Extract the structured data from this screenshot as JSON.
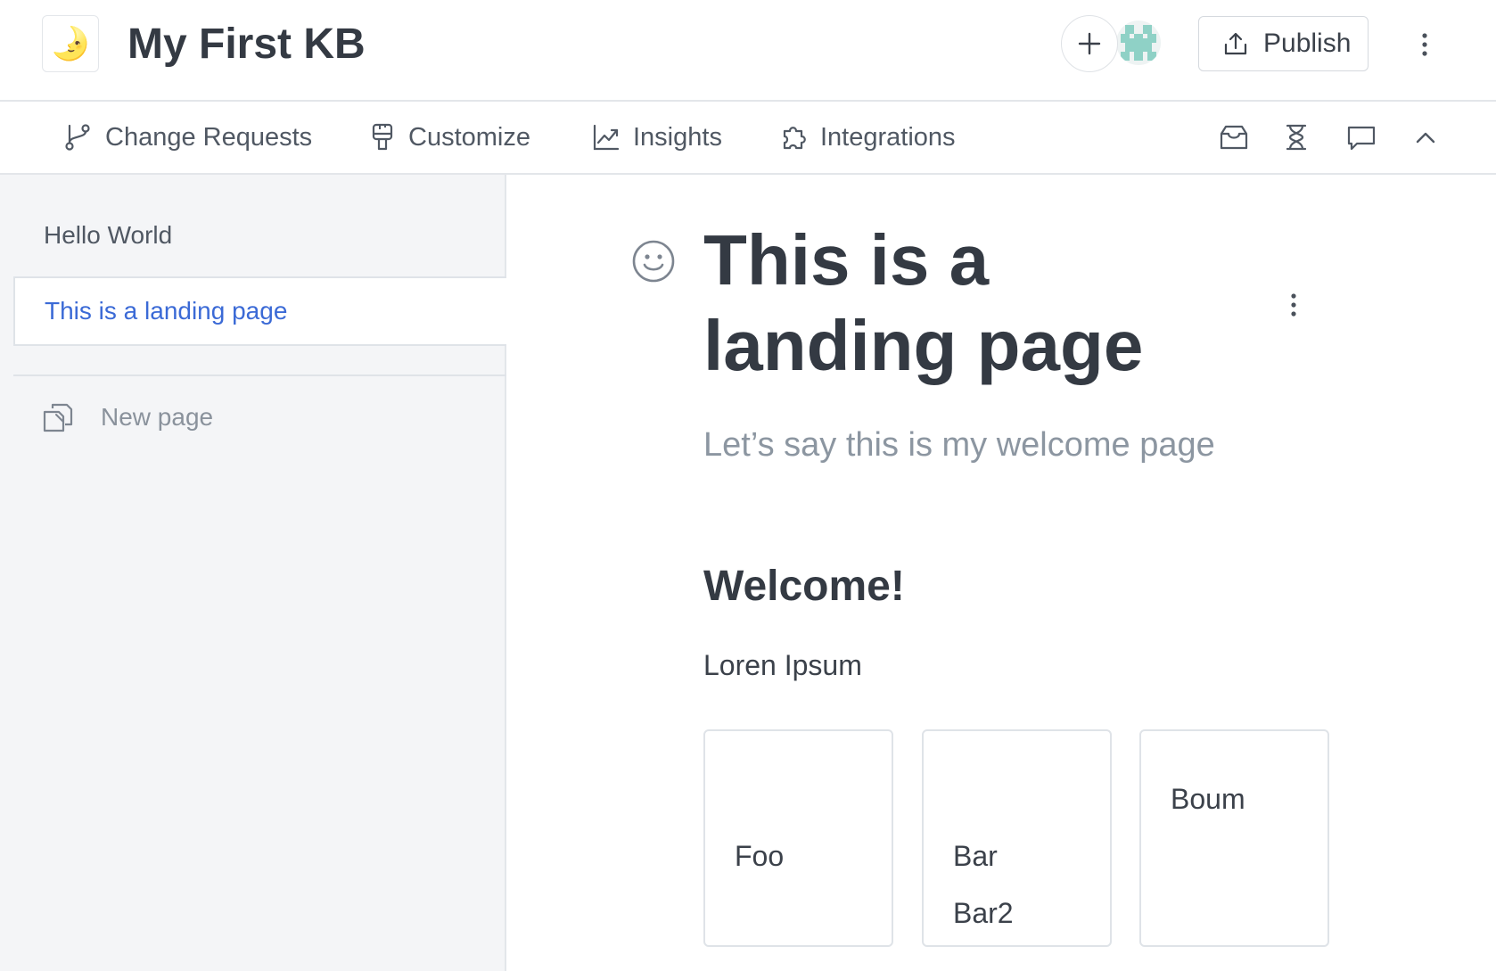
{
  "header": {
    "logo_glyph": "🌛",
    "title": "My First KB",
    "add_icon": "plus-icon",
    "publish_label": "Publish"
  },
  "toolbar": {
    "items": [
      {
        "label": "Change Requests",
        "icon": "branch-icon"
      },
      {
        "label": "Customize",
        "icon": "paintbrush-icon"
      },
      {
        "label": "Insights",
        "icon": "chart-icon"
      },
      {
        "label": "Integrations",
        "icon": "puzzle-icon"
      }
    ],
    "right_icons": [
      "inbox-icon",
      "hourglass-icon",
      "comment-icon",
      "chevron-up-icon"
    ]
  },
  "sidebar": {
    "items": [
      {
        "label": "Hello World",
        "active": false
      },
      {
        "label": "This is a landing page",
        "active": true
      }
    ],
    "new_page_label": "New page"
  },
  "page": {
    "emoji_icon": "smiley-icon",
    "title": "This is a landing page",
    "description": "Let’s say this is my welcome page",
    "heading": "Welcome!",
    "paragraph": "Loren Ipsum",
    "cards": [
      {
        "lines": [
          "Foo"
        ]
      },
      {
        "lines": [
          "Bar",
          "Bar2"
        ]
      },
      {
        "lines": [
          "Boum"
        ]
      }
    ]
  },
  "colors": {
    "accent": "#3b6ad6",
    "text": "#343a43",
    "muted": "#8c96a1",
    "sidebar_bg": "#f4f5f7",
    "border": "#e3e6ea"
  }
}
